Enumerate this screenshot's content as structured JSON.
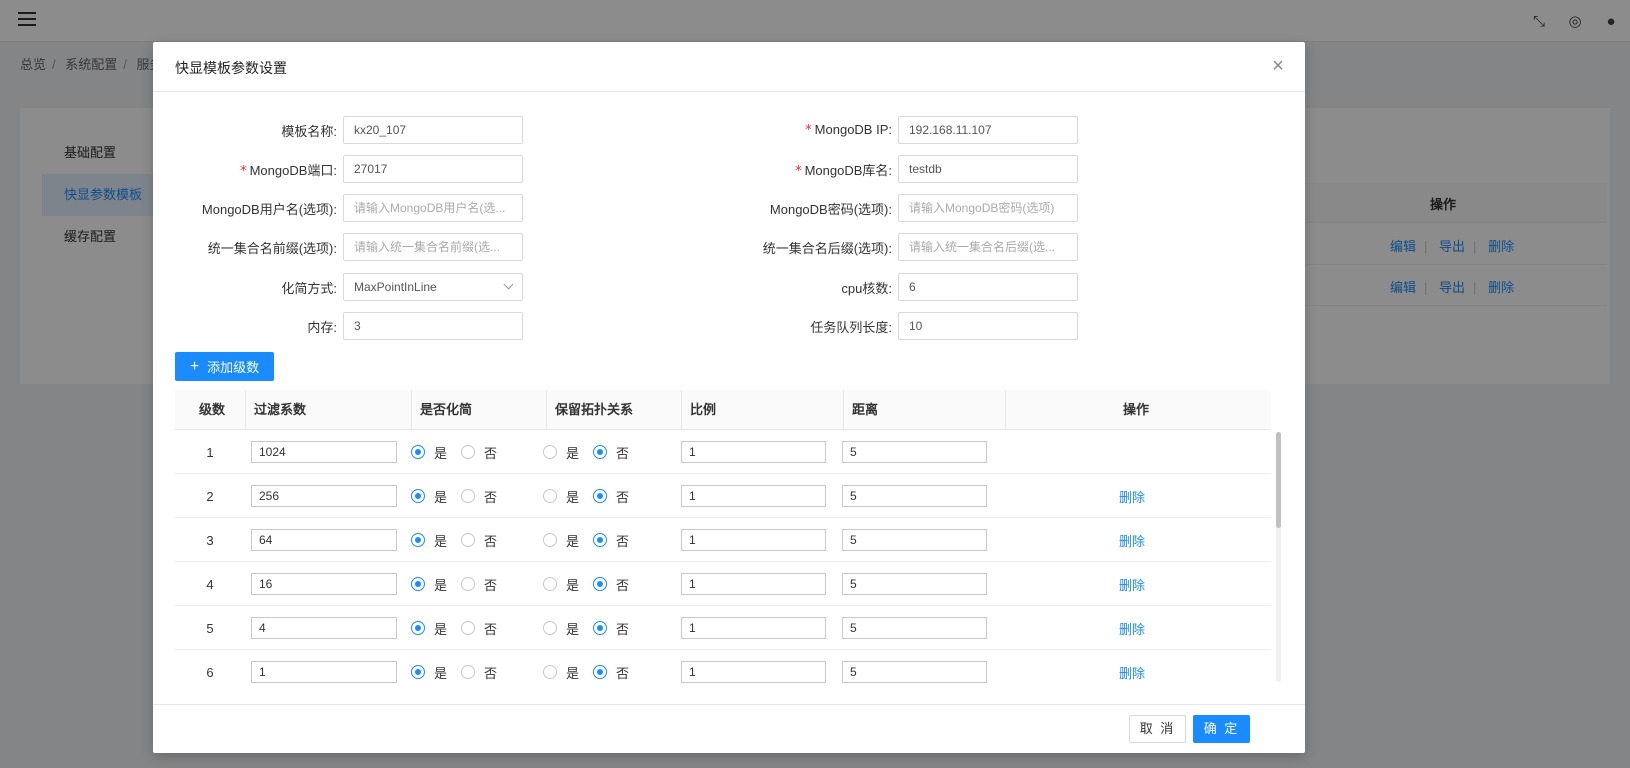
{
  "app": {
    "breadcrumb": [
      "总览",
      "系统配置",
      "服务"
    ],
    "side_menu": [
      "基础配置",
      "快显参数模板",
      "缓存配置"
    ],
    "table": {
      "op_header": "操作",
      "row_links": [
        "编辑",
        "导出",
        "删除"
      ]
    }
  },
  "modal": {
    "title": "快显模板参数设置",
    "close_icon": "close-icon",
    "form": {
      "template_name": {
        "label": "模板名称:",
        "value": "kx20_107"
      },
      "mongo_ip": {
        "label": "MongoDB IP:",
        "value": "192.168.11.107"
      },
      "mongo_port": {
        "label": "MongoDB端口:",
        "value": "27017"
      },
      "mongo_db": {
        "label": "MongoDB库名:",
        "value": "testdb"
      },
      "mongo_user": {
        "label": "MongoDB用户名(选项):",
        "placeholder": "请输入MongoDB用户名(选..."
      },
      "mongo_pwd": {
        "label": "MongoDB密码(选项):",
        "placeholder": "请输入MongoDB密码(选项)"
      },
      "prefix": {
        "label": "统一集合名前缀(选项):",
        "placeholder": "请输入统一集合名前缀(选..."
      },
      "suffix": {
        "label": "统一集合名后缀(选项):",
        "placeholder": "请输入统一集合名后缀(选..."
      },
      "simplify": {
        "label": "化简方式:",
        "value": "MaxPointInLine"
      },
      "cpu": {
        "label": "cpu核数:",
        "value": "6"
      },
      "memory": {
        "label": "内存:",
        "value": "3"
      },
      "queue": {
        "label": "任务队列长度:",
        "value": "10"
      }
    },
    "add_level_button": "添加级数",
    "levels_table": {
      "headers": [
        "级数",
        "过滤系数",
        "是否化简",
        "保留拓扑关系",
        "比例",
        "距离",
        "操作"
      ],
      "yes": "是",
      "no": "否",
      "delete": "删除",
      "rows": [
        {
          "level": "1",
          "filter": "1024",
          "simplify": "是",
          "topology": "否",
          "ratio": "1",
          "distance": "5"
        },
        {
          "level": "2",
          "filter": "256",
          "simplify": "是",
          "topology": "否",
          "ratio": "1",
          "distance": "5"
        },
        {
          "level": "3",
          "filter": "64",
          "simplify": "是",
          "topology": "否",
          "ratio": "1",
          "distance": "5"
        },
        {
          "level": "4",
          "filter": "16",
          "simplify": "是",
          "topology": "否",
          "ratio": "1",
          "distance": "5"
        },
        {
          "level": "5",
          "filter": "4",
          "simplify": "是",
          "topology": "否",
          "ratio": "1",
          "distance": "5"
        },
        {
          "level": "6",
          "filter": "1",
          "simplify": "是",
          "topology": "否",
          "ratio": "1",
          "distance": "5"
        }
      ]
    },
    "footer": {
      "cancel": "取 消",
      "ok": "确 定"
    }
  },
  "colors": {
    "accent": "#1a8cff",
    "required": "#f5222d"
  }
}
